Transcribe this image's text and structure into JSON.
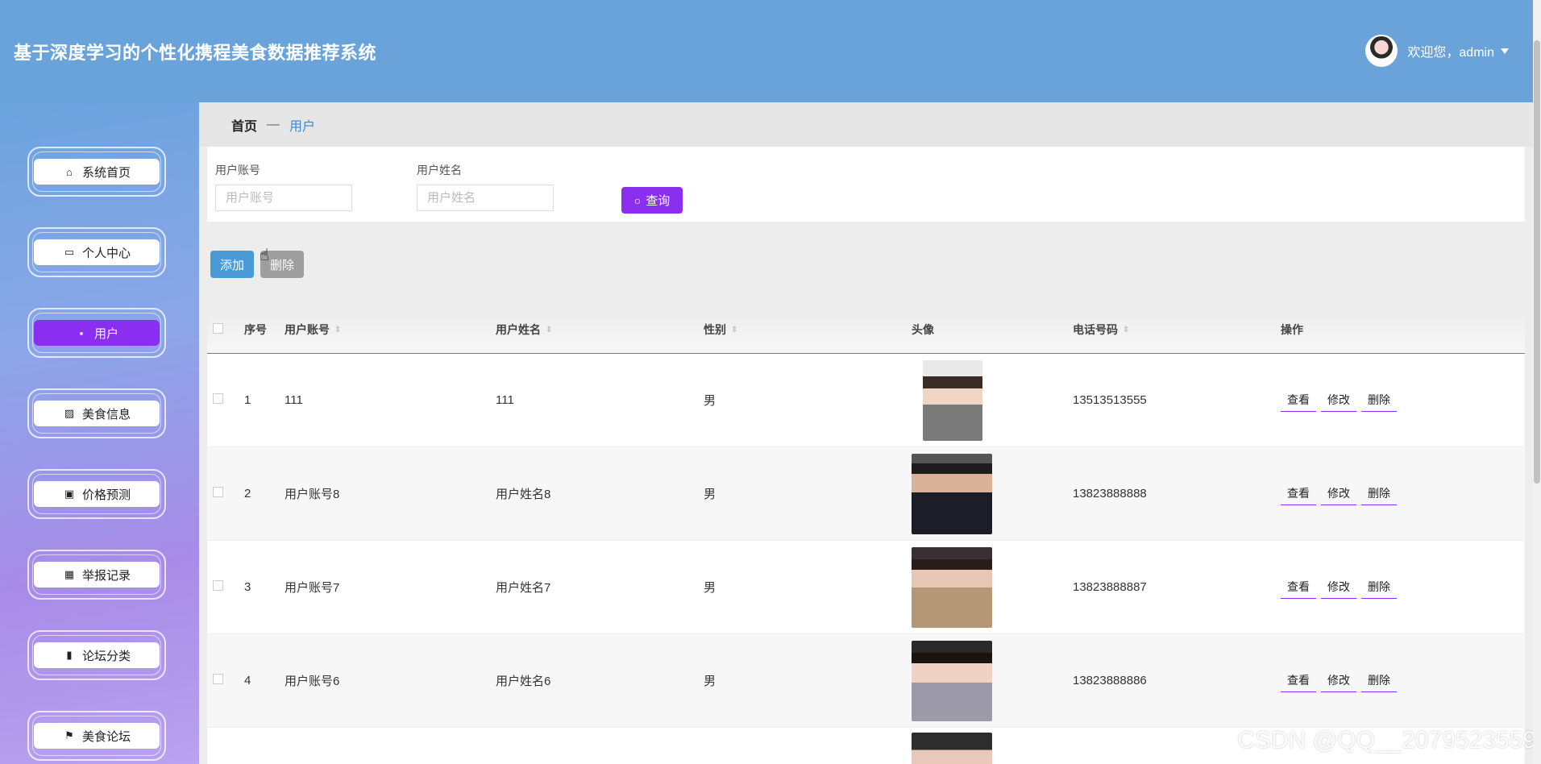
{
  "header": {
    "title": "基于深度学习的个性化携程美食数据推荐系统",
    "welcome": "欢迎您，admin"
  },
  "sidebar": {
    "items": [
      {
        "label": "系统首页",
        "icon": "home-icon"
      },
      {
        "label": "个人中心",
        "icon": "card-icon"
      },
      {
        "label": "用户",
        "icon": "chat-icon",
        "active": true
      },
      {
        "label": "美食信息",
        "icon": "chart-icon"
      },
      {
        "label": "价格预测",
        "icon": "clipboard-icon"
      },
      {
        "label": "举报记录",
        "icon": "grid-icon"
      },
      {
        "label": "论坛分类",
        "icon": "bar-chart-icon"
      },
      {
        "label": "美食论坛",
        "icon": "flag-icon"
      }
    ]
  },
  "breadcrumb": {
    "home": "首页",
    "sep": "—",
    "current": "用户"
  },
  "search": {
    "account_label": "用户账号",
    "account_placeholder": "用户账号",
    "name_label": "用户姓名",
    "name_placeholder": "用户姓名",
    "query_label": "查询"
  },
  "actions": {
    "add": "添加",
    "delete": "删除"
  },
  "table": {
    "headers": {
      "index": "序号",
      "account": "用户账号",
      "name": "用户姓名",
      "gender": "性别",
      "avatar": "头像",
      "phone": "电话号码",
      "ops": "操作"
    },
    "rows": [
      {
        "index": "1",
        "account": "111",
        "name": "111",
        "gender": "男",
        "phone": "13513513555"
      },
      {
        "index": "2",
        "account": "用户账号8",
        "name": "用户姓名8",
        "gender": "男",
        "phone": "13823888888"
      },
      {
        "index": "3",
        "account": "用户账号7",
        "name": "用户姓名7",
        "gender": "男",
        "phone": "13823888887"
      },
      {
        "index": "4",
        "account": "用户账号6",
        "name": "用户姓名6",
        "gender": "男",
        "phone": "13823888886"
      }
    ],
    "ops": {
      "view": "查看",
      "edit": "修改",
      "delete": "删除"
    }
  },
  "watermark": "CSDN @QQ__2079523559"
}
